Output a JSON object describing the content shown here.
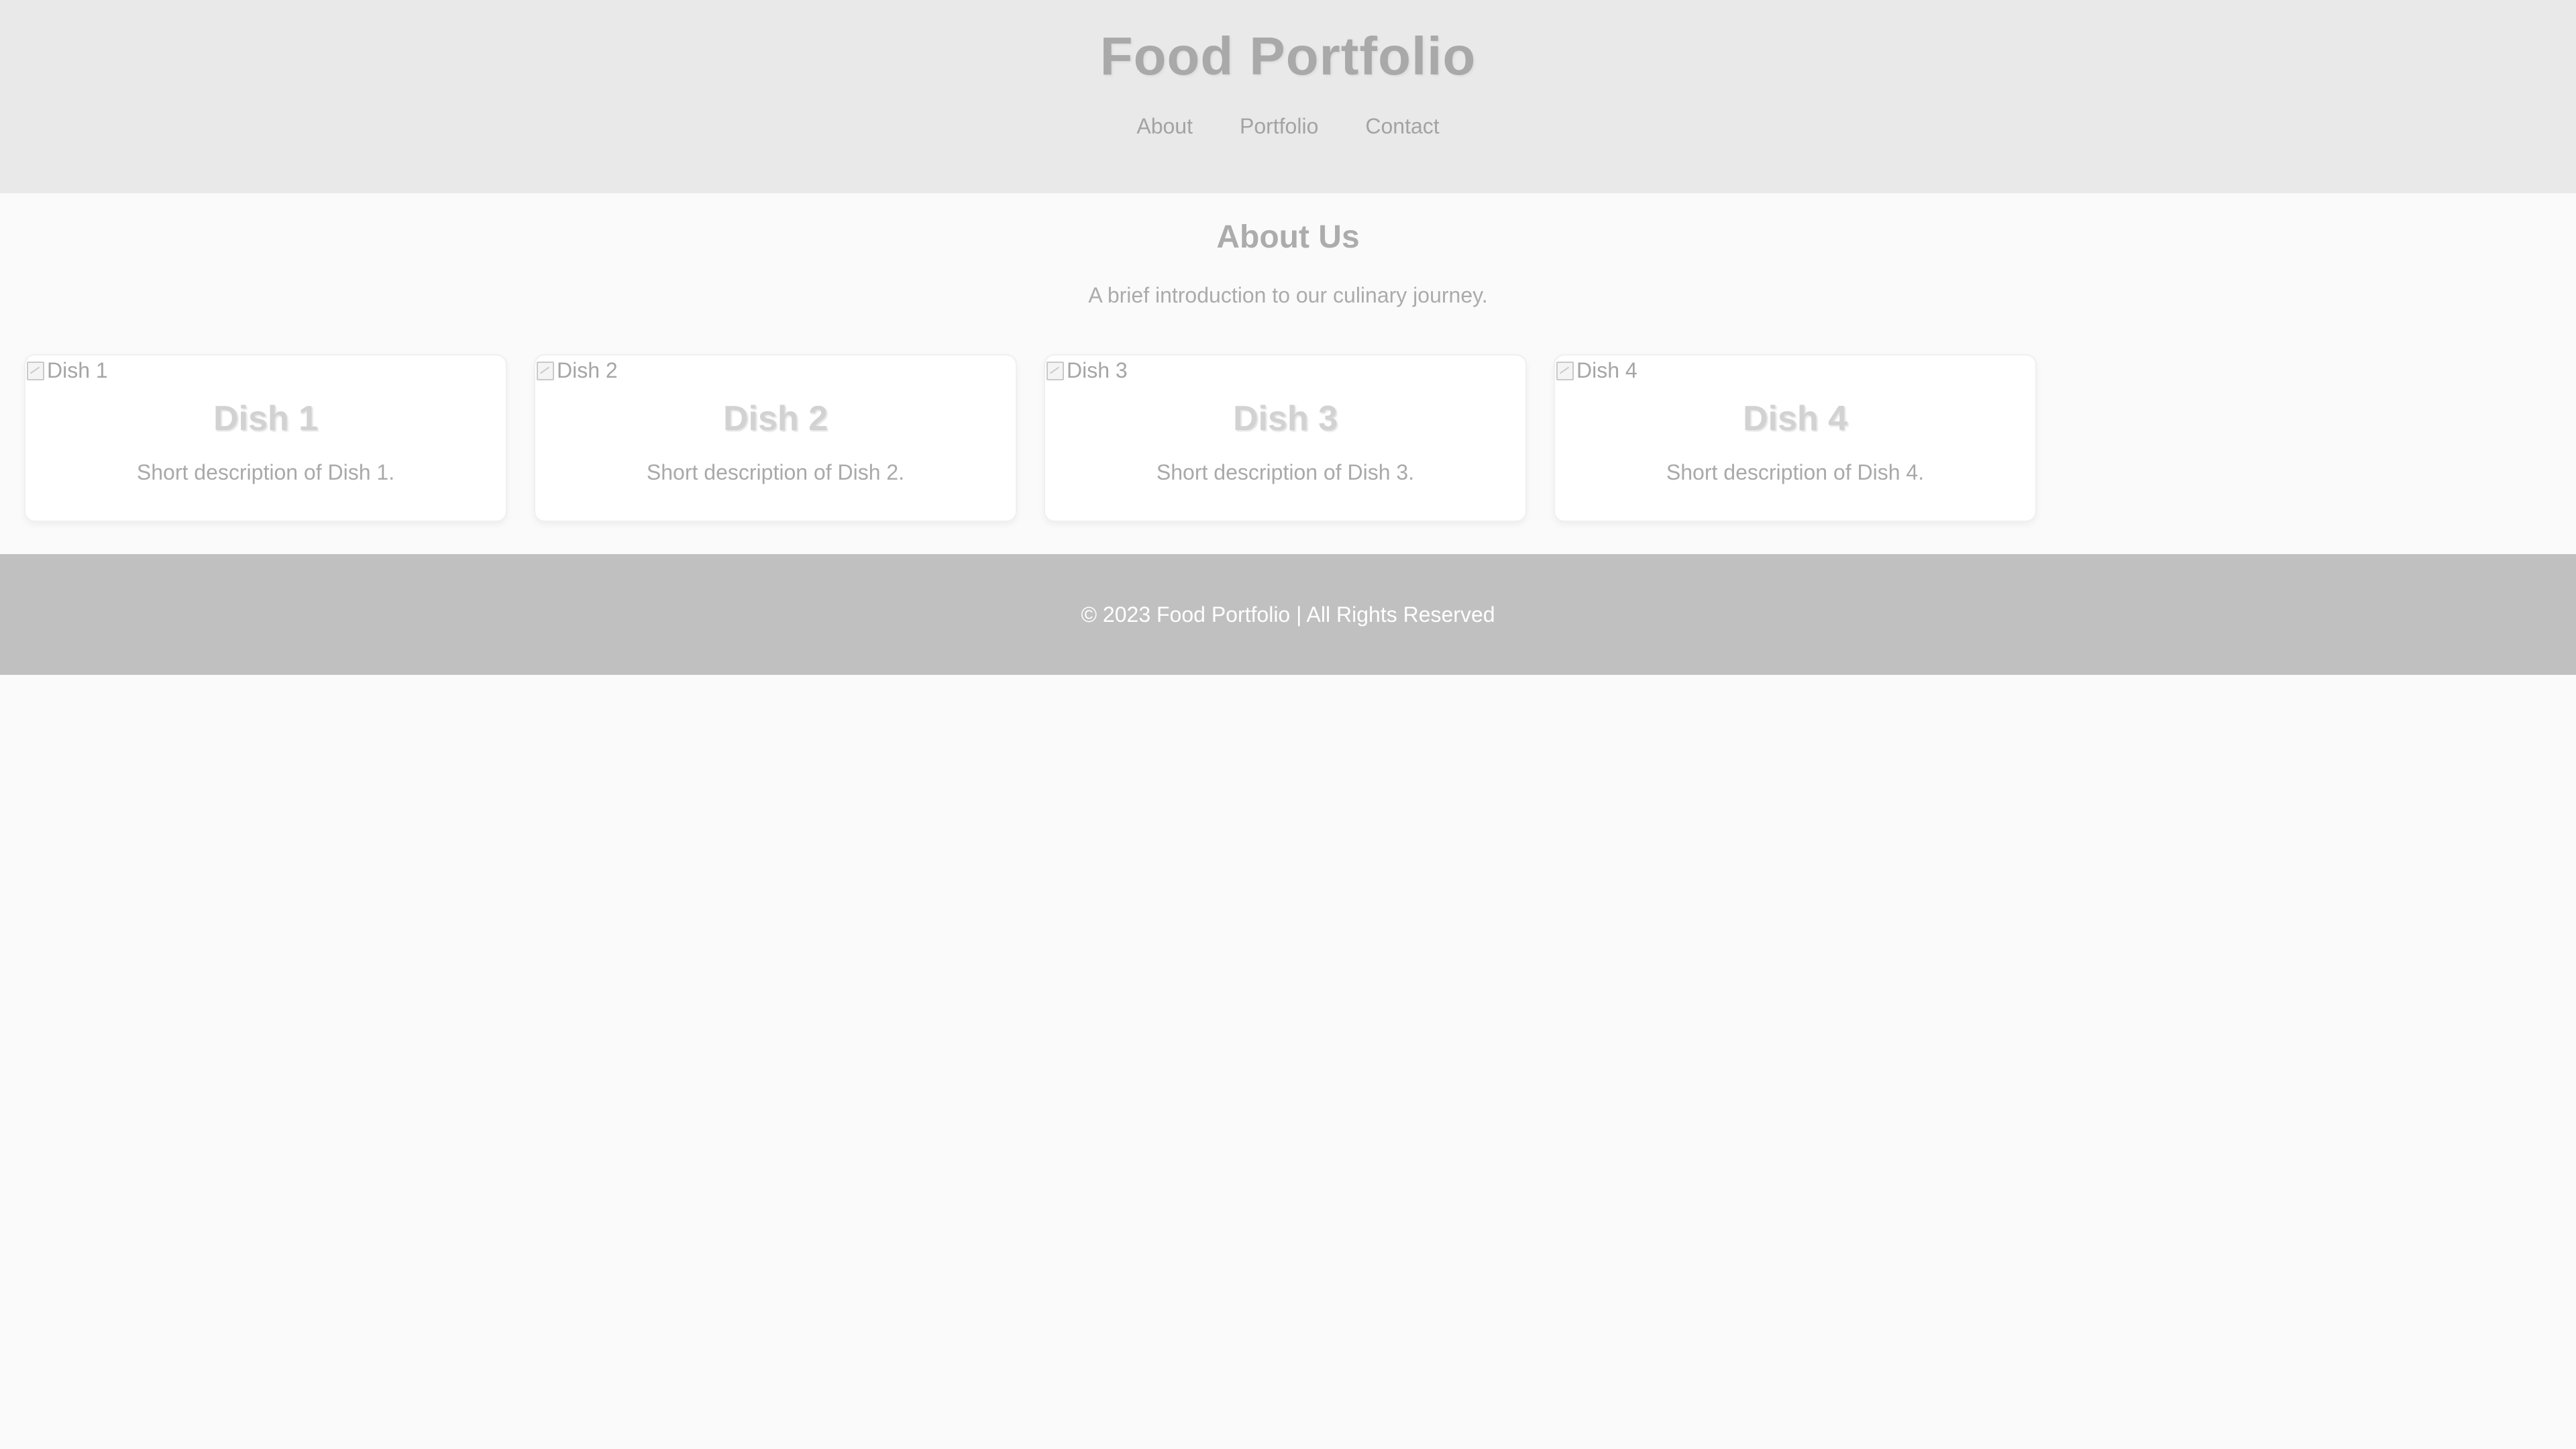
{
  "header": {
    "title": "Food Portfolio",
    "nav": [
      {
        "label": "About"
      },
      {
        "label": "Portfolio"
      },
      {
        "label": "Contact"
      }
    ]
  },
  "about": {
    "heading": "About Us",
    "text": "A brief introduction to our culinary journey."
  },
  "portfolio": {
    "cards": [
      {
        "image_alt": "Dish 1",
        "title": "Dish 1",
        "description": "Short description of Dish 1."
      },
      {
        "image_alt": "Dish 2",
        "title": "Dish 2",
        "description": "Short description of Dish 2."
      },
      {
        "image_alt": "Dish 3",
        "title": "Dish 3",
        "description": "Short description of Dish 3."
      },
      {
        "image_alt": "Dish 4",
        "title": "Dish 4",
        "description": "Short description of Dish 4."
      }
    ]
  },
  "footer": {
    "text": "© 2023 Food Portfolio | All Rights Reserved"
  },
  "colors": {
    "header_bg": "#e9e9e9",
    "page_bg": "#fafafa",
    "footer_bg": "#c0c0c0",
    "card_bg": "#ffffff",
    "footer_text": "#ffffff"
  },
  "icons": {
    "card_image": "broken-image-icon"
  }
}
